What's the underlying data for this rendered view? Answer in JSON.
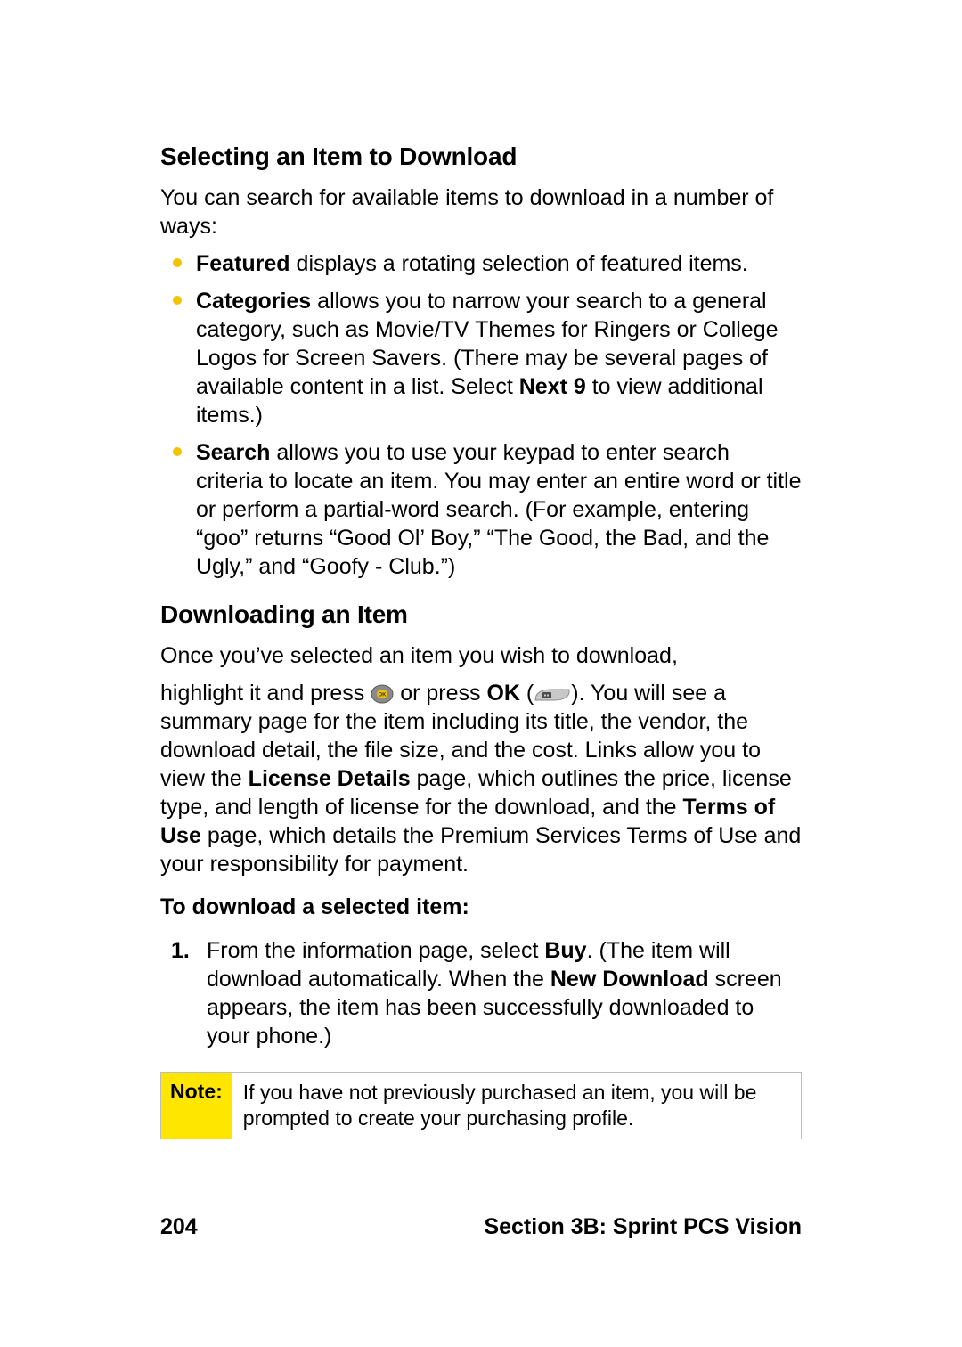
{
  "section1": {
    "heading": "Selecting an Item to Download",
    "intro": "You can search for available items to download in a number of ways:",
    "bullets": {
      "b1_lead": "Featured",
      "b1_rest": " displays a rotating selection of featured items.",
      "b2_lead": "Categories",
      "b2_mid": " allows you to narrow your search to a general category, such as Movie/TV Themes for Ringers or College Logos for Screen Savers. (There may be several pages of available content in a list. Select ",
      "b2_bold": "Next 9",
      "b2_end": " to view additional items.)",
      "b3_lead": "Search",
      "b3_rest": " allows you to use your keypad to enter search criteria to locate an item. You may enter an entire word or title or perform a partial-word search. (For example, entering “goo” returns “Good Ol’ Boy,” “The Good, the Bad, and the Ugly,” and “Goofy - Club.”)"
    }
  },
  "section2": {
    "heading": "Downloading an Item",
    "p1": "Once you’ve selected an item you wish to download,",
    "p2_a": "highlight it and press ",
    "p2_b": " or press ",
    "ok_label": "OK",
    "p2_c": " (",
    "p2_d": "). You will see a summary page for the item including its title, the vendor, the download detail, the file size, and the cost. Links allow you to view the ",
    "license_details": "License Details",
    "p2_e": " page, which outlines the price, license type, and length of license for the download, and the ",
    "terms_of_use": "Terms of Use",
    "p2_f": " page, which details the Premium Services Terms of Use and your responsibility for payment.",
    "sub_heading": "To download a selected item:",
    "step_marker": "1.",
    "step_a": "From the information page, select ",
    "buy": "Buy",
    "step_b": ". (The item will download automatically. When the ",
    "new_download": "New Download",
    "step_c": " screen appears, the item has been successfully downloaded to your phone.)"
  },
  "note": {
    "label": "Note:",
    "text": "If you have not previously purchased an item, you will be prompted to create your purchasing profile."
  },
  "footer": {
    "page_number": "204",
    "section_label": "Section 3B: Sprint PCS Vision"
  }
}
